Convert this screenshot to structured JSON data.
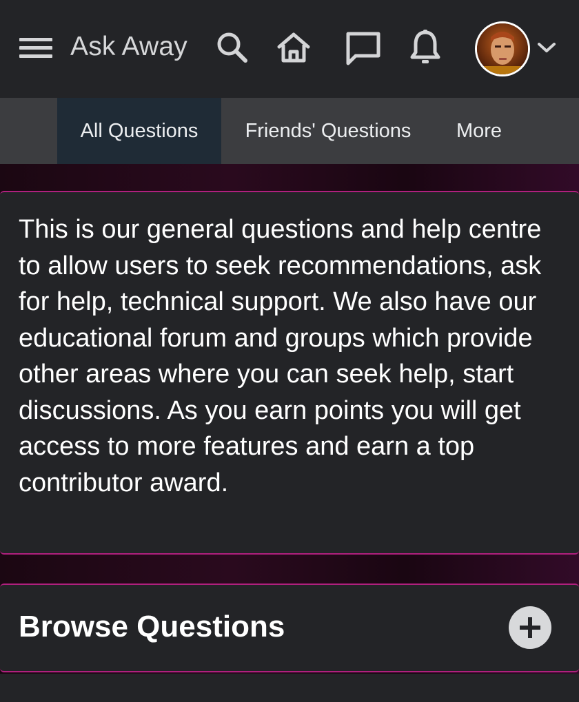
{
  "header": {
    "app_title": "Ask Away",
    "icons": [
      "menu-icon",
      "search-icon",
      "home-icon",
      "chat-icon",
      "bell-icon",
      "avatar",
      "chevron-down-icon"
    ]
  },
  "tabs": [
    {
      "label": "All Questions",
      "active": true
    },
    {
      "label": "Friends' Questions",
      "active": false
    },
    {
      "label": "More",
      "active": false
    }
  ],
  "intro": {
    "text": "This is our general questions and help centre to allow users to seek recommendations, ask for help, technical support. We also have our educational forum and groups which provide other areas where you can seek help, start discussions. As you earn points you will get access to more features and earn a top contributor award."
  },
  "browse": {
    "title": "Browse Questions",
    "action_icon": "plus-icon"
  },
  "colors": {
    "topbar": "#232427",
    "tabbar": "#3c3d40",
    "active_tab": "#1f2b36",
    "accent_border": "#b0207e",
    "card_bg": "#232427"
  }
}
